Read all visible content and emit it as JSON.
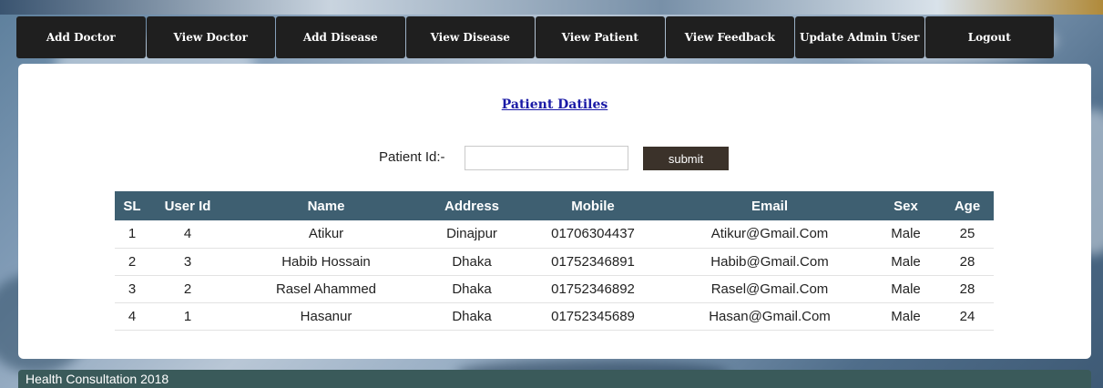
{
  "nav": [
    {
      "label": "Add Doctor"
    },
    {
      "label": "View Doctor"
    },
    {
      "label": "Add Disease"
    },
    {
      "label": "View Disease"
    },
    {
      "label": "View Patient"
    },
    {
      "label": "View Feedback"
    },
    {
      "label": "Update Admin User"
    },
    {
      "label": "Logout"
    }
  ],
  "panel": {
    "title": "Patient Datiles",
    "form": {
      "label": "Patient Id:-",
      "input_value": "",
      "submit_label": "submit"
    }
  },
  "table": {
    "headers": [
      "SL",
      "User Id",
      "Name",
      "Address",
      "Mobile",
      "Email",
      "Sex",
      "Age"
    ],
    "rows": [
      [
        "1",
        "4",
        "Atikur",
        "Dinajpur",
        "01706304437",
        "Atikur@Gmail.Com",
        "Male",
        "25"
      ],
      [
        "2",
        "3",
        "Habib Hossain",
        "Dhaka",
        "01752346891",
        "Habib@Gmail.Com",
        "Male",
        "28"
      ],
      [
        "3",
        "2",
        "Rasel Ahammed",
        "Dhaka",
        "01752346892",
        "Rasel@Gmail.Com",
        "Male",
        "28"
      ],
      [
        "4",
        "1",
        "Hasanur",
        "Dhaka",
        "01752345689",
        "Hasan@Gmail.Com",
        "Male",
        "24"
      ]
    ]
  },
  "footer": {
    "text": "Health Consultation 2018"
  },
  "colors": {
    "nav_bg": "#1f1f1f",
    "header_bg": "#3e5f71",
    "submit_bg": "#3b322a",
    "footer_bg": "#3a5a5a",
    "title_link": "#1a1aa6"
  }
}
